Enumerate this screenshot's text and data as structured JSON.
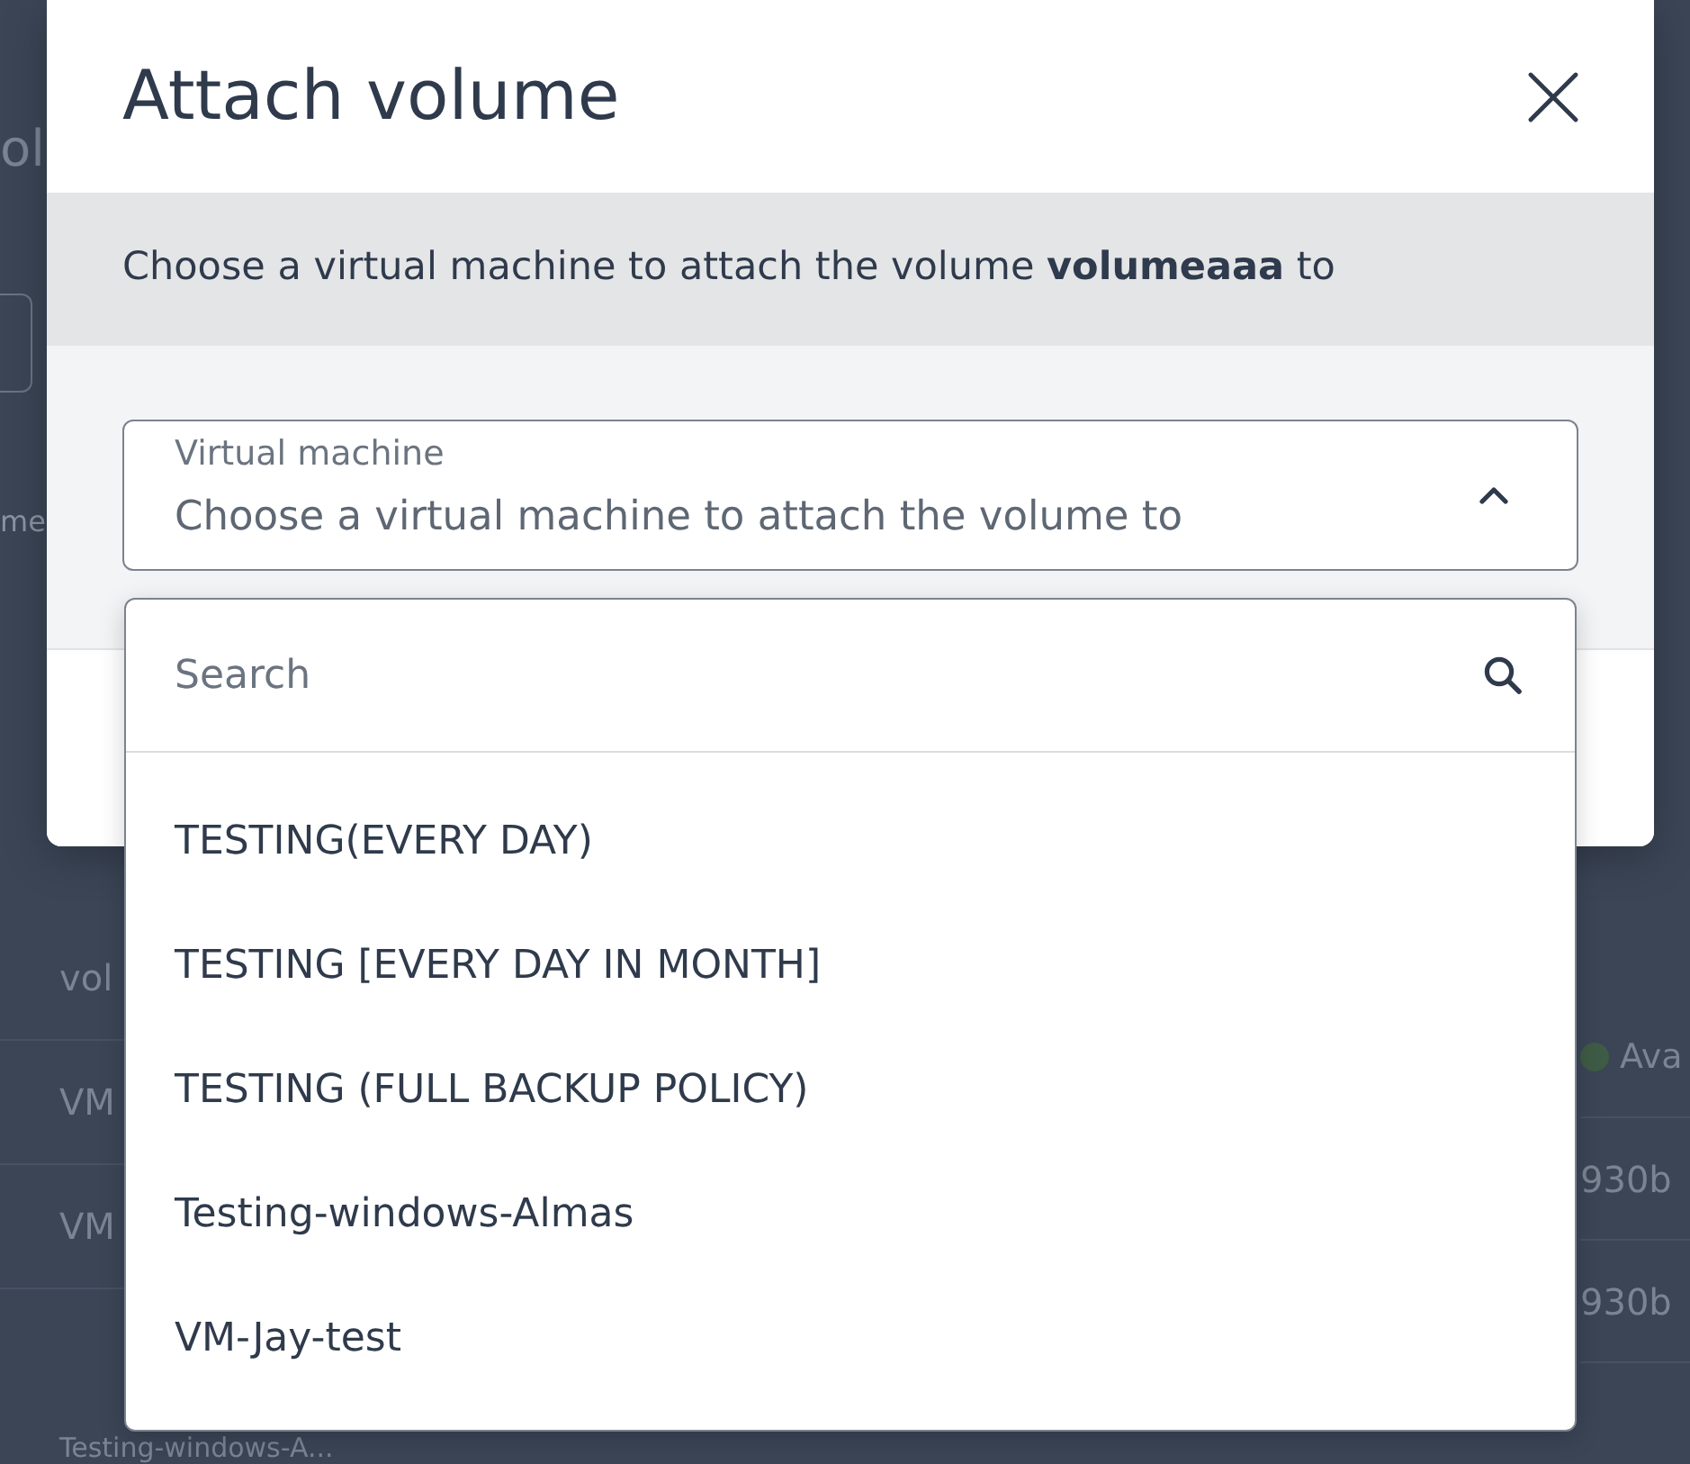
{
  "background_page": {
    "heading": "ol",
    "column_header": "me",
    "name_column": [
      {
        "text": "vol"
      },
      {
        "text": "VM"
      },
      {
        "text": "VM"
      },
      {
        "text": "Testing-windows-A..."
      }
    ],
    "status_column": [
      {
        "kind": "status",
        "text": "Ava",
        "color": "#3e5b45"
      },
      {
        "kind": "text",
        "text": "930b"
      },
      {
        "kind": "text",
        "text": "930b"
      }
    ]
  },
  "dialog": {
    "title": "Attach volume",
    "description": "Choose a virtual machine to attach the volume **volumeaaa** to",
    "select": {
      "label": "Virtual machine",
      "placeholder": "Choose a virtual machine to attach the volume to",
      "expanded": true
    },
    "menu": {
      "search": {
        "placeholder": "Search"
      },
      "options": [
        {
          "label": "TESTING(EVERY DAY)",
          "selected": false
        },
        {
          "label": "TESTING [EVERY DAY IN MONTH]",
          "selected": false
        },
        {
          "label": "TESTING (FULL BACKUP POLICY)",
          "selected": false
        },
        {
          "label": "Testing-windows-Almas",
          "selected": false
        },
        {
          "label": "VM-Jay-test",
          "selected": false
        }
      ]
    }
  }
}
